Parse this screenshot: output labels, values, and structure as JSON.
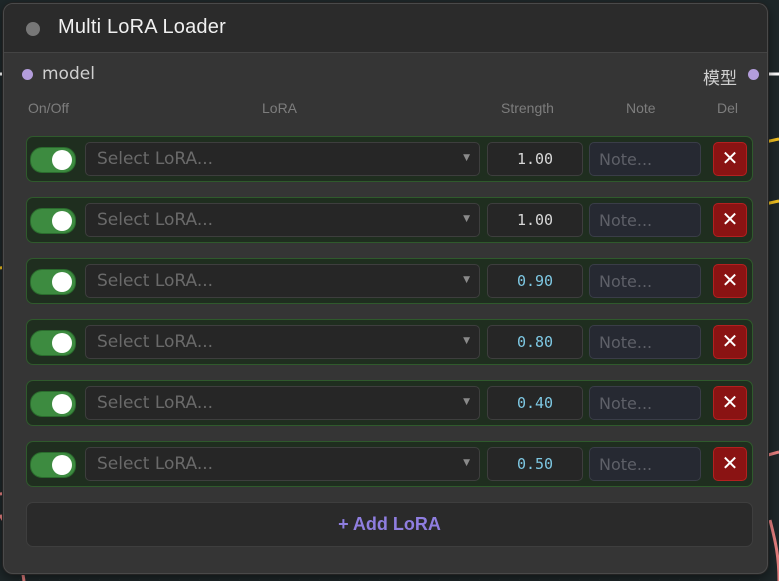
{
  "node": {
    "title": "Multi LoRA Loader",
    "input_label": "model",
    "output_label": "模型"
  },
  "columns": {
    "onoff": "On/Off",
    "lora": "LoRA",
    "strength": "Strength",
    "note": "Note",
    "del": "Del"
  },
  "rows": [
    {
      "enabled": true,
      "lora_placeholder": "Select LoRA...",
      "strength": "1.00",
      "strength_color": "#d8d8d8",
      "note_placeholder": "Note...",
      "del_label": "✕"
    },
    {
      "enabled": true,
      "lora_placeholder": "Select LoRA...",
      "strength": "1.00",
      "strength_color": "#d8d8d8",
      "note_placeholder": "Note...",
      "del_label": "✕"
    },
    {
      "enabled": true,
      "lora_placeholder": "Select LoRA...",
      "strength": "0.90",
      "strength_color": "#7ec8e3",
      "note_placeholder": "Note...",
      "del_label": "✕"
    },
    {
      "enabled": true,
      "lora_placeholder": "Select LoRA...",
      "strength": "0.80",
      "strength_color": "#7ec8e3",
      "note_placeholder": "Note...",
      "del_label": "✕"
    },
    {
      "enabled": true,
      "lora_placeholder": "Select LoRA...",
      "strength": "0.40",
      "strength_color": "#7ec8e3",
      "note_placeholder": "Note...",
      "del_label": "✕"
    },
    {
      "enabled": true,
      "lora_placeholder": "Select LoRA...",
      "strength": "0.50",
      "strength_color": "#7ec8e3",
      "note_placeholder": "Note...",
      "del_label": "✕"
    }
  ],
  "add_button": {
    "label": "+ Add LoRA"
  },
  "colors": {
    "accent": "#8f7ee0",
    "toggle_on": "#3d8b40",
    "delete": "#8a1313",
    "slot": "#b39ddb"
  }
}
